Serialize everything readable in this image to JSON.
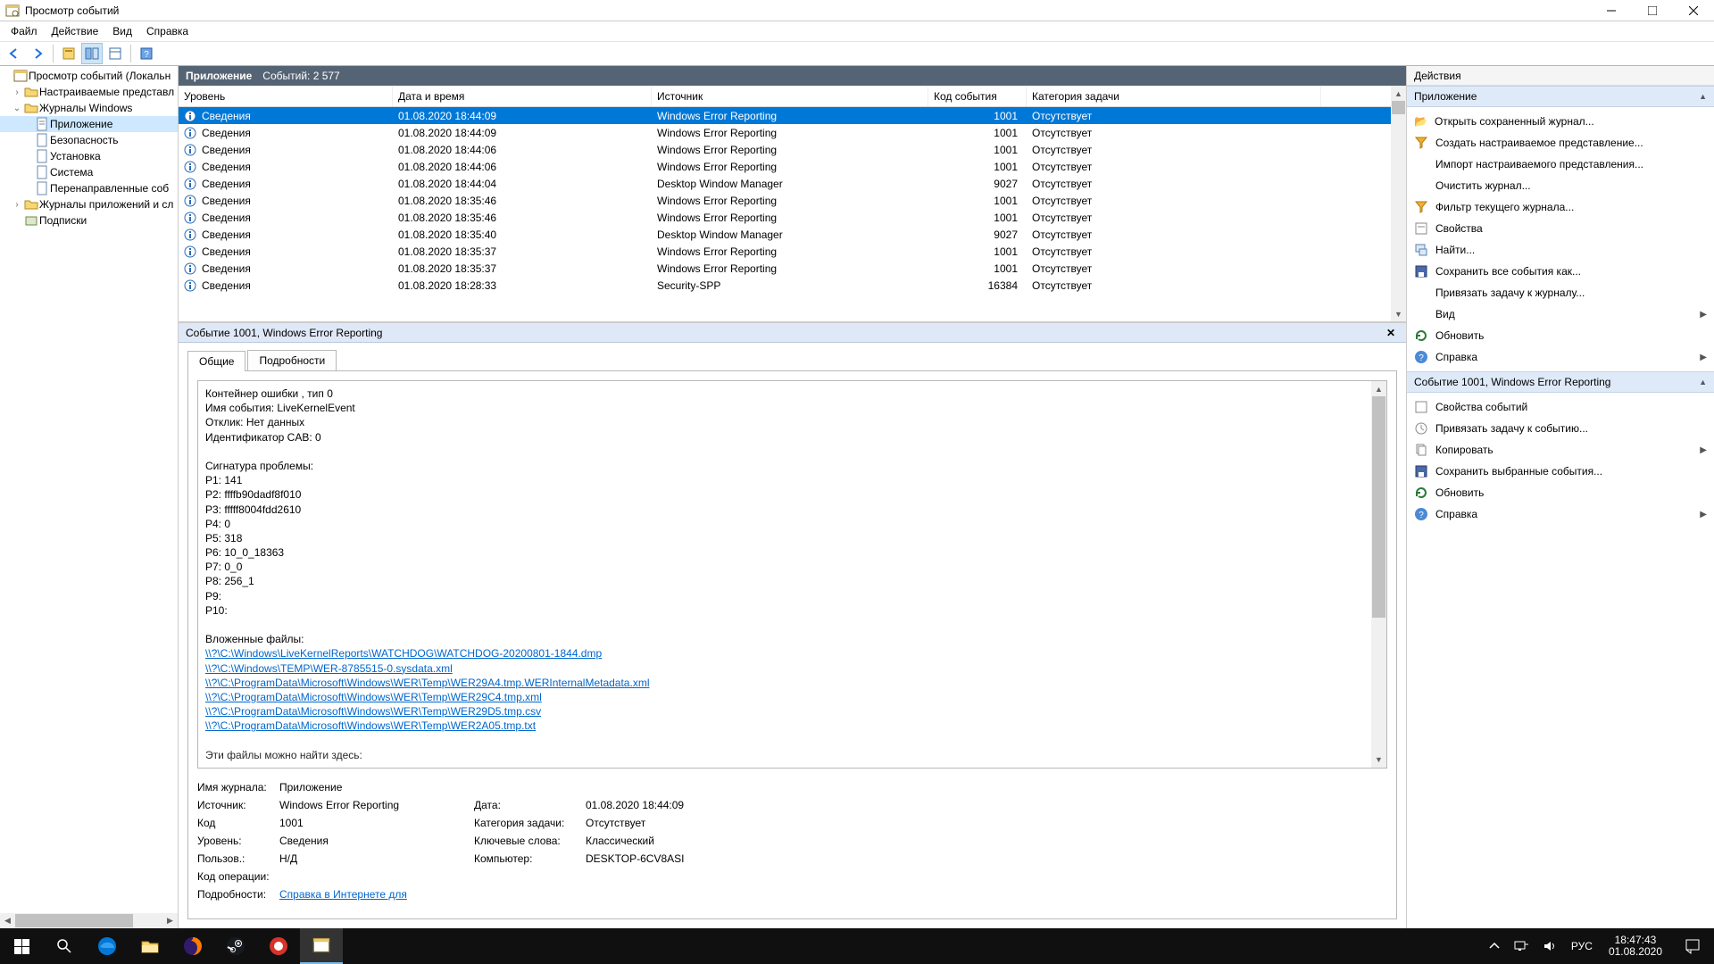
{
  "window": {
    "title": "Просмотр событий"
  },
  "menu": {
    "file": "Файл",
    "action": "Действие",
    "view": "Вид",
    "help": "Справка"
  },
  "tree": {
    "root": "Просмотр событий (Локальн",
    "custom": "Настраиваемые представл",
    "winlogs": "Журналы Windows",
    "app": "Приложение",
    "security": "Безопасность",
    "setup": "Установка",
    "system": "Система",
    "forwarded": "Перенаправленные соб",
    "appservlogs": "Журналы приложений и сл",
    "subscriptions": "Подписки"
  },
  "listHeader": {
    "logname": "Приложение",
    "count_label": "Событий: 2 577"
  },
  "cols": {
    "level": "Уровень",
    "date": "Дата и время",
    "source": "Источник",
    "id": "Код события",
    "cat": "Категория задачи"
  },
  "level_info": "Сведения",
  "cat_none": "Отсутствует",
  "rows": [
    {
      "date": "01.08.2020 18:44:09",
      "src": "Windows Error Reporting",
      "id": "1001",
      "sel": true
    },
    {
      "date": "01.08.2020 18:44:09",
      "src": "Windows Error Reporting",
      "id": "1001"
    },
    {
      "date": "01.08.2020 18:44:06",
      "src": "Windows Error Reporting",
      "id": "1001"
    },
    {
      "date": "01.08.2020 18:44:06",
      "src": "Windows Error Reporting",
      "id": "1001"
    },
    {
      "date": "01.08.2020 18:44:04",
      "src": "Desktop Window Manager",
      "id": "9027"
    },
    {
      "date": "01.08.2020 18:35:46",
      "src": "Windows Error Reporting",
      "id": "1001"
    },
    {
      "date": "01.08.2020 18:35:46",
      "src": "Windows Error Reporting",
      "id": "1001"
    },
    {
      "date": "01.08.2020 18:35:40",
      "src": "Desktop Window Manager",
      "id": "9027"
    },
    {
      "date": "01.08.2020 18:35:37",
      "src": "Windows Error Reporting",
      "id": "1001"
    },
    {
      "date": "01.08.2020 18:35:37",
      "src": "Windows Error Reporting",
      "id": "1001"
    },
    {
      "date": "01.08.2020 18:28:33",
      "src": "Security-SPP",
      "id": "16384"
    }
  ],
  "detail": {
    "title": "Событие 1001, Windows Error Reporting",
    "tab_general": "Общие",
    "tab_details": "Подробности",
    "body": {
      "l1": "Контейнер ошибки , тип 0",
      "l2": "Имя события: LiveKernelEvent",
      "l3": "Отклик: Нет данных",
      "l4": "Идентификатор CAB: 0",
      "l5": "Сигнатура проблемы:",
      "p1": "P1: 141",
      "p2": "P2: ffffb90dadf8f010",
      "p3": "P3: fffff8004fdd2610",
      "p4": "P4: 0",
      "p5": "P5: 318",
      "p6": "P6: 10_0_18363",
      "p7": "P7: 0_0",
      "p8": "P8: 256_1",
      "p9": "P9:",
      "p10": "P10:",
      "att": "Вложенные файлы:",
      "a1": "\\\\?\\C:\\Windows\\LiveKernelReports\\WATCHDOG\\WATCHDOG-20200801-1844.dmp",
      "a2": "\\\\?\\C:\\Windows\\TEMP\\WER-8785515-0.sysdata.xml",
      "a3": "\\\\?\\C:\\ProgramData\\Microsoft\\Windows\\WER\\Temp\\WER29A4.tmp.WERInternalMetadata.xml",
      "a4": "\\\\?\\C:\\ProgramData\\Microsoft\\Windows\\WER\\Temp\\WER29C4.tmp.xml",
      "a5": "\\\\?\\C:\\ProgramData\\Microsoft\\Windows\\WER\\Temp\\WER29D5.tmp.csv",
      "a6": "\\\\?\\C:\\ProgramData\\Microsoft\\Windows\\WER\\Temp\\WER2A05.tmp.txt",
      "foot": "Эти файлы можно найти здесь:"
    },
    "meta": {
      "logname_l": "Имя журнала:",
      "logname_v": "Приложение",
      "src_l": "Источник:",
      "src_v": "Windows Error Reporting",
      "date_l": "Дата:",
      "date_v": "01.08.2020 18:44:09",
      "code_l": "Код",
      "code_v": "1001",
      "cat_l": "Категория задачи:",
      "cat_v": "Отсутствует",
      "level_l": "Уровень:",
      "level_v": "Сведения",
      "kw_l": "Ключевые слова:",
      "kw_v": "Классический",
      "user_l": "Пользов.:",
      "user_v": "Н/Д",
      "comp_l": "Компьютер:",
      "comp_v": "DESKTOP-6CV8ASI",
      "opcode_l": "Код операции:",
      "details_l": "Подробности:",
      "details_link": "Справка в Интернете для "
    }
  },
  "actions": {
    "title": "Действия",
    "sec1": "Приложение",
    "open": "Открыть сохраненный журнал...",
    "createView": "Создать настраиваемое представление...",
    "importView": "Импорт настраиваемого представления...",
    "clear": "Очистить журнал...",
    "filter": "Фильтр текущего журнала...",
    "props": "Свойства",
    "find": "Найти...",
    "saveAll": "Сохранить все события как...",
    "attach": "Привязать задачу к журналу...",
    "view": "Вид",
    "refresh": "Обновить",
    "help": "Справка",
    "sec2": "Событие 1001, Windows Error Reporting",
    "evtProps": "Свойства событий",
    "evtAttach": "Привязать задачу к событию...",
    "copy": "Копировать",
    "saveSel": "Сохранить выбранные события...",
    "refresh2": "Обновить",
    "help2": "Справка"
  },
  "taskbar": {
    "lang": "РУС",
    "time": "18:47:43",
    "date": "01.08.2020"
  }
}
